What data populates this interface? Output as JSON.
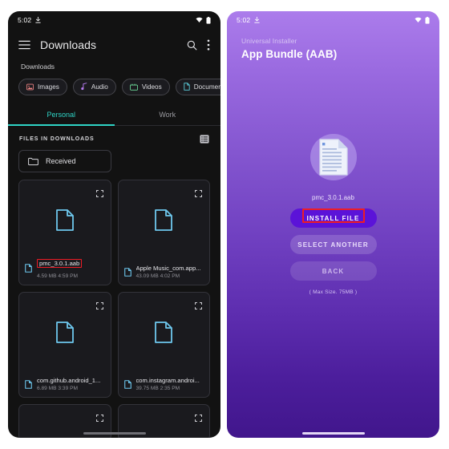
{
  "left": {
    "status": {
      "time": "5:02",
      "download_icon": "download-icon",
      "wifi_icon": "wifi-icon",
      "battery_icon": "battery-icon"
    },
    "appbar": {
      "menu_icon": "hamburger-menu-icon",
      "title": "Downloads",
      "search_icon": "search-icon",
      "overflow_icon": "overflow-menu-icon"
    },
    "breadcrumb": "Downloads",
    "chips": [
      {
        "label": "Images",
        "icon": "image-icon",
        "color": "#ef8585"
      },
      {
        "label": "Audio",
        "icon": "music-note-icon",
        "color": "#b57bef"
      },
      {
        "label": "Videos",
        "icon": "video-icon",
        "color": "#6edc9a"
      },
      {
        "label": "Documents",
        "icon": "document-icon",
        "color": "#5ed3e0"
      }
    ],
    "tabs": [
      {
        "label": "Personal",
        "active": true
      },
      {
        "label": "Work",
        "active": false
      }
    ],
    "files_section": {
      "label": "FILES IN DOWNLOADS",
      "view_toggle_icon": "list-view-icon"
    },
    "folder": {
      "label": "Received",
      "icon": "folder-icon"
    },
    "files": [
      {
        "name": "pmc_3.0.1.aab",
        "size": "4.59 MB",
        "time": "4:59 PM",
        "highlighted": true
      },
      {
        "name": "Apple Music_com.app...",
        "size": "43.09 MB",
        "time": "4:02 PM",
        "highlighted": false
      },
      {
        "name": "com.github.android_1...",
        "size": "6.89 MB",
        "time": "3:39 PM",
        "highlighted": false
      },
      {
        "name": "com.instagram.androi...",
        "size": "39.75 MB",
        "time": "2:35 PM",
        "highlighted": false
      }
    ]
  },
  "right": {
    "status": {
      "time": "5:02",
      "download_icon": "download-icon",
      "wifi_icon": "wifi-icon",
      "battery_icon": "battery-icon"
    },
    "subtitle": "Universal Installer",
    "title": "App Bundle (AAB)",
    "file_icon": "aab-document-icon",
    "filename": "pmc_3.0.1.aab",
    "buttons": [
      {
        "label": "INSTALL FILE",
        "style": "primary",
        "highlighted": true
      },
      {
        "label": "SELECT ANOTHER",
        "style": "secondary",
        "highlighted": false
      },
      {
        "label": "BACK",
        "style": "tertiary",
        "highlighted": false
      }
    ],
    "note": "( Max Size. 75MB )"
  },
  "colors": {
    "accent_teal": "#2fd4c6",
    "accent_blue": "#6ec8ee",
    "highlight_red": "#ee1c25",
    "primary_purple": "#5b13d8"
  }
}
